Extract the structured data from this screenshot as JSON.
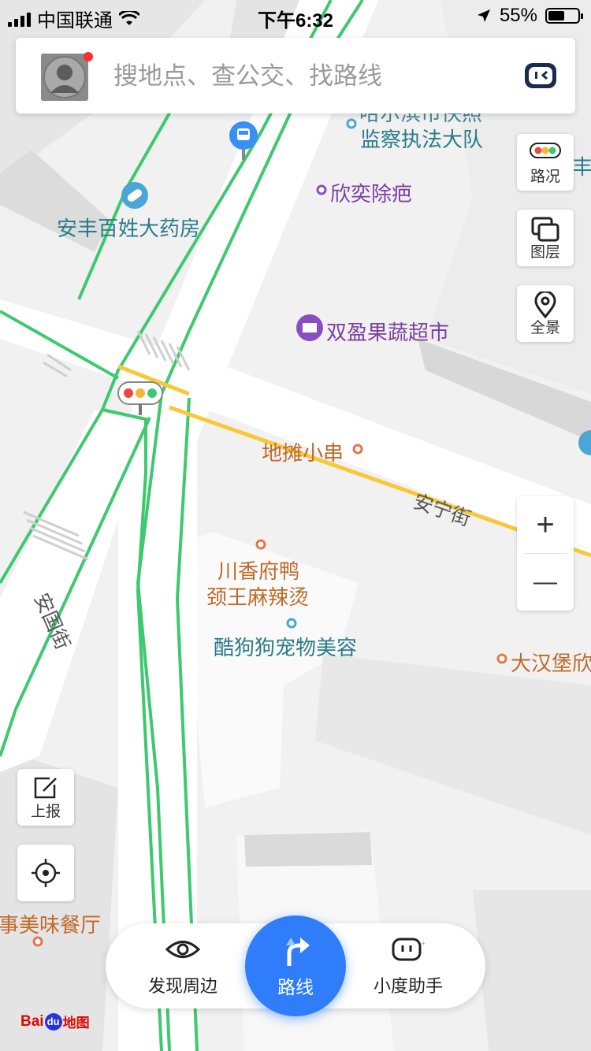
{
  "status_bar": {
    "carrier": "中国联通",
    "time": "下午6:32",
    "battery_percent": "55%",
    "battery_level": 0.55
  },
  "search": {
    "placeholder": "搜地点、查公交、找路线"
  },
  "right_controls": {
    "traffic_label": "路况",
    "layers_label": "图层",
    "panorama_label": "全景",
    "zoom_in": "+",
    "zoom_out": "—"
  },
  "left_controls": {
    "report_label": "上报"
  },
  "pois": [
    {
      "name": "哈尔滨市快照",
      "type": "teal"
    },
    {
      "name": "监察执法大队",
      "type": "teal"
    },
    {
      "name": "欣奕除疤",
      "type": "purple"
    },
    {
      "name": "安丰百姓大药房",
      "type": "teal"
    },
    {
      "name": "双盈果蔬超市",
      "type": "purple"
    },
    {
      "name": "地摊小串",
      "type": "orange"
    },
    {
      "name": "川香府鸭",
      "type": "orange"
    },
    {
      "name": "颈王麻辣烫",
      "type": "orange"
    },
    {
      "name": "酷狗狗宠物美容",
      "type": "teal"
    },
    {
      "name": "大汉堡欣",
      "type": "orange"
    },
    {
      "name": "事美味餐厅",
      "type": "orange"
    },
    {
      "name": "丰",
      "type": "teal"
    }
  ],
  "streets": {
    "anning": "安宁街",
    "anguo": "安国街"
  },
  "bottom_bar": {
    "discover_label": "发现周边",
    "route_label": "路线",
    "assistant_label": "小度助手"
  },
  "logo": {
    "bai": "Bai",
    "du": "du",
    "map": "地图"
  },
  "colors": {
    "accent_blue": "#2f7dfa",
    "road_green": "#3ec970",
    "road_yellow": "#f7c93a",
    "poi_teal": "#2a7b8a",
    "poi_purple": "#7b40a0",
    "poi_orange": "#c06a2a"
  }
}
